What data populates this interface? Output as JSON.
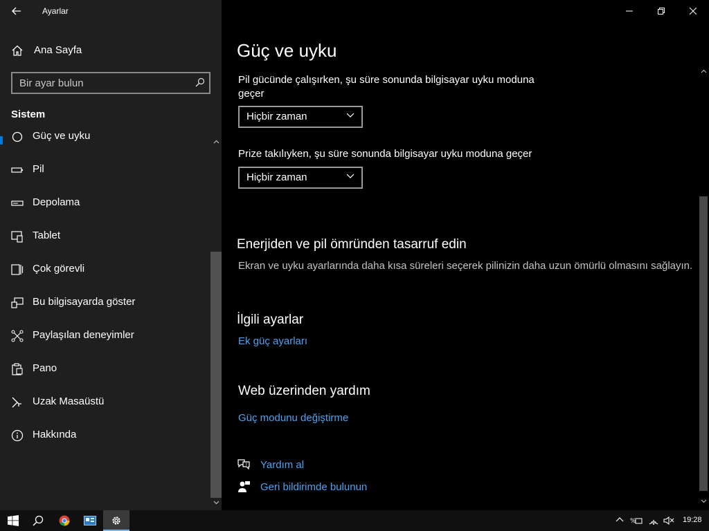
{
  "window": {
    "title": "Ayarlar",
    "minimize_icon": "minimize-icon",
    "maximize_icon": "restore-icon",
    "close_icon": "close-icon"
  },
  "sidebar": {
    "home_label": "Ana Sayfa",
    "search_placeholder": "Bir ayar bulun",
    "section_title": "Sistem",
    "items": [
      {
        "label": "Güç ve uyku",
        "icon": "power-icon",
        "selected": true
      },
      {
        "label": "Pil",
        "icon": "battery-icon"
      },
      {
        "label": "Depolama",
        "icon": "storage-icon"
      },
      {
        "label": "Tablet",
        "icon": "tablet-icon"
      },
      {
        "label": "Çok görevli",
        "icon": "multitasking-icon"
      },
      {
        "label": "Bu bilgisayarda göster",
        "icon": "projecting-icon"
      },
      {
        "label": "Paylaşılan deneyimler",
        "icon": "shared-experiences-icon"
      },
      {
        "label": "Pano",
        "icon": "clipboard-icon"
      },
      {
        "label": "Uzak Masaüstü",
        "icon": "remote-desktop-icon"
      },
      {
        "label": "Hakkında",
        "icon": "info-icon"
      }
    ]
  },
  "main": {
    "title": "Güç ve uyku",
    "battery_sleep_label": "Pil gücünde çalışırken, şu süre sonunda bilgisayar uyku moduna geçer",
    "battery_sleep_value": "Hiçbir zaman",
    "plugged_sleep_label": "Prize takılıyken, şu süre sonunda bilgisayar uyku moduna geçer",
    "plugged_sleep_value": "Hiçbir zaman",
    "save_energy_title": "Enerjiden ve pil ömründen tasarruf edin",
    "save_energy_desc": "Ekran ve uyku ayarlarında daha kısa süreleri seçerek pilinizin daha uzun ömürlü olmasını sağlayın.",
    "related_title": "İlgili ayarlar",
    "related_link": "Ek güç ayarları",
    "web_help_title": "Web üzerinden yardım",
    "web_help_link": "Güç modunu değiştirme",
    "get_help": "Yardım al",
    "feedback": "Geri bildirimde bulunun"
  },
  "taskbar": {
    "clock": "19:28",
    "accent": "#76b9ed"
  },
  "colors": {
    "link": "#4da2f2",
    "selection": "#0078d7"
  }
}
